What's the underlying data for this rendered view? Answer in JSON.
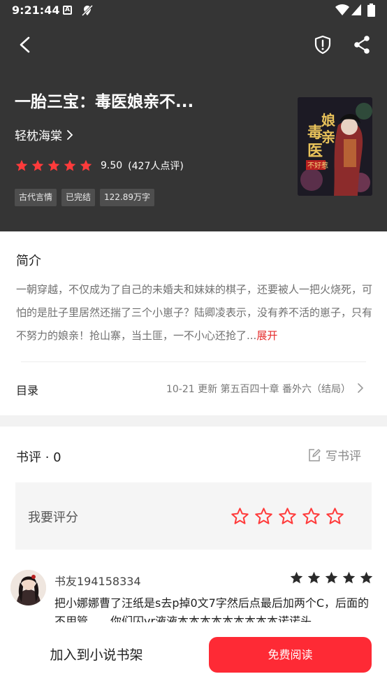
{
  "status_bar": {
    "time": "9:21:44",
    "icons": [
      "a-icon",
      "location-off-icon",
      "wifi-icon",
      "cell-signal-icon",
      "battery-icon"
    ]
  },
  "header": {
    "back_icon": "chevron-left-icon",
    "report_icon": "shield-alert-icon",
    "share_icon": "share-icon"
  },
  "book": {
    "title": "一胎三宝：毒医娘亲不...",
    "author": "轻枕海棠",
    "rating": {
      "stars": 5,
      "score": "9.50",
      "count": "(427人点评)"
    },
    "tags": [
      "古代言情",
      "已完结",
      "122.89万字"
    ],
    "cover_text": "毒医娘亲不好惹"
  },
  "intro": {
    "title": "简介",
    "text": "一朝穿越，不仅成为了自己的未婚夫和妹妹的棋子，还要被人一把火烧死，可怕的是肚子里居然还揣了三个小崽子？陆卿凌表示，没有养不活的崽子，只有不努力的娘亲！抢山寨，当土匪，一不小心还抢了...",
    "more": "展开"
  },
  "toc": {
    "label": "目录",
    "info": "10-21  更新  第五百四十章 番外六（结局）"
  },
  "reviews": {
    "title": "书评 · 0",
    "write_label": "写书评",
    "rate_label": "我要评分",
    "rate_stars": 5,
    "items": [
      {
        "user": "书友194158334",
        "stars": 5,
        "text": "把小娜娜曹了汪纸是s去p掉0文7字然后点最后加两个C，后面的不用管……你们囚vr液液本本本本本本本本本诺诺头"
      }
    ]
  },
  "bottom_bar": {
    "add_shelf": "加入到小说书架",
    "read": "免费阅读"
  },
  "colors": {
    "header_bg": "#353535",
    "accent": "#fe2a35",
    "star": "#ff3b3b",
    "link": "#e52d2d"
  }
}
